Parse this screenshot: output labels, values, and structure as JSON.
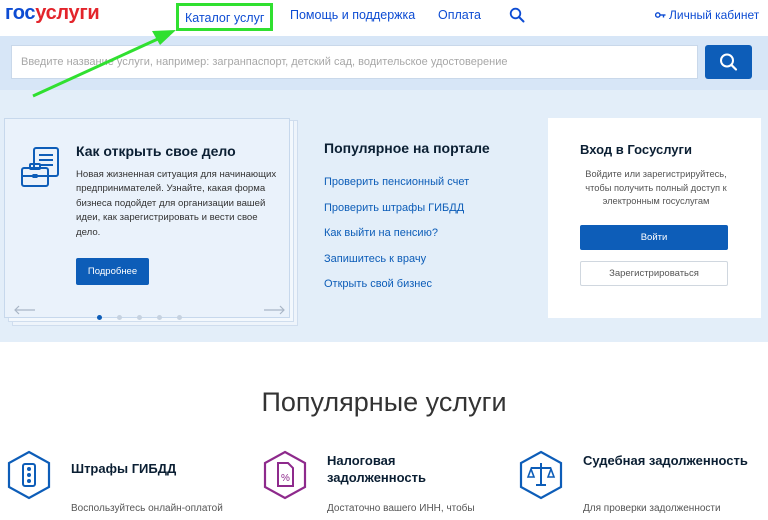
{
  "header": {
    "logo_part1": "гос",
    "logo_part2": "услуги",
    "nav": {
      "catalog": "Каталог услуг",
      "help": "Помощь и поддержка",
      "payment": "Оплата",
      "search_icon": "search-icon"
    },
    "cabinet": "Личный кабинет",
    "cabinet_icon": "key-icon"
  },
  "search": {
    "placeholder": "Введите название услуги, например: загранпаспорт, детский сад, водительское удостоверение",
    "button_icon": "search-icon"
  },
  "annotation": {
    "highlight_color": "#30e030"
  },
  "hero": {
    "card": {
      "title": "Как открыть свое дело",
      "text": "Новая жизненная ситуация для начинающих предпринимателей. Узнайте, какая форма бизнеса подойдет для организации вашей идеи, как зарегистрировать и вести свое дело.",
      "button": "Подробнее",
      "icon": "documents-briefcase-icon",
      "slides_total": 5,
      "active_slide": 1
    },
    "popular": {
      "title": "Популярное на портале",
      "links": [
        "Проверить пенсионный счет",
        "Проверить штрафы ГИБДД",
        "Как выйти на пенсию?",
        "Запишитесь к врачу",
        "Открыть свой бизнес"
      ]
    },
    "login": {
      "title": "Вход в Госуслуги",
      "text": "Войдите или зарегистрируйтесь, чтобы получить полный доступ к электронным госуслугам",
      "login_button": "Войти",
      "register_button": "Зарегистрироваться"
    }
  },
  "services": {
    "title": "Популярные услуги",
    "items": [
      {
        "name": "Штрафы ГИБДД",
        "desc": "Воспользуйтесь онлайн-оплатой",
        "icon": "traffic-light-icon"
      },
      {
        "name": "Налоговая задолженность",
        "desc": "Достаточно вашего ИНН, чтобы",
        "icon": "tax-document-icon"
      },
      {
        "name": "Судебная задолженность",
        "desc": "Для проверки задолженности",
        "icon": "scales-icon"
      }
    ]
  },
  "colors": {
    "brand_blue": "#0d4cd3",
    "brand_red": "#e3242b",
    "button_blue": "#0d5db8",
    "hero_bg": "#e3eef9"
  }
}
